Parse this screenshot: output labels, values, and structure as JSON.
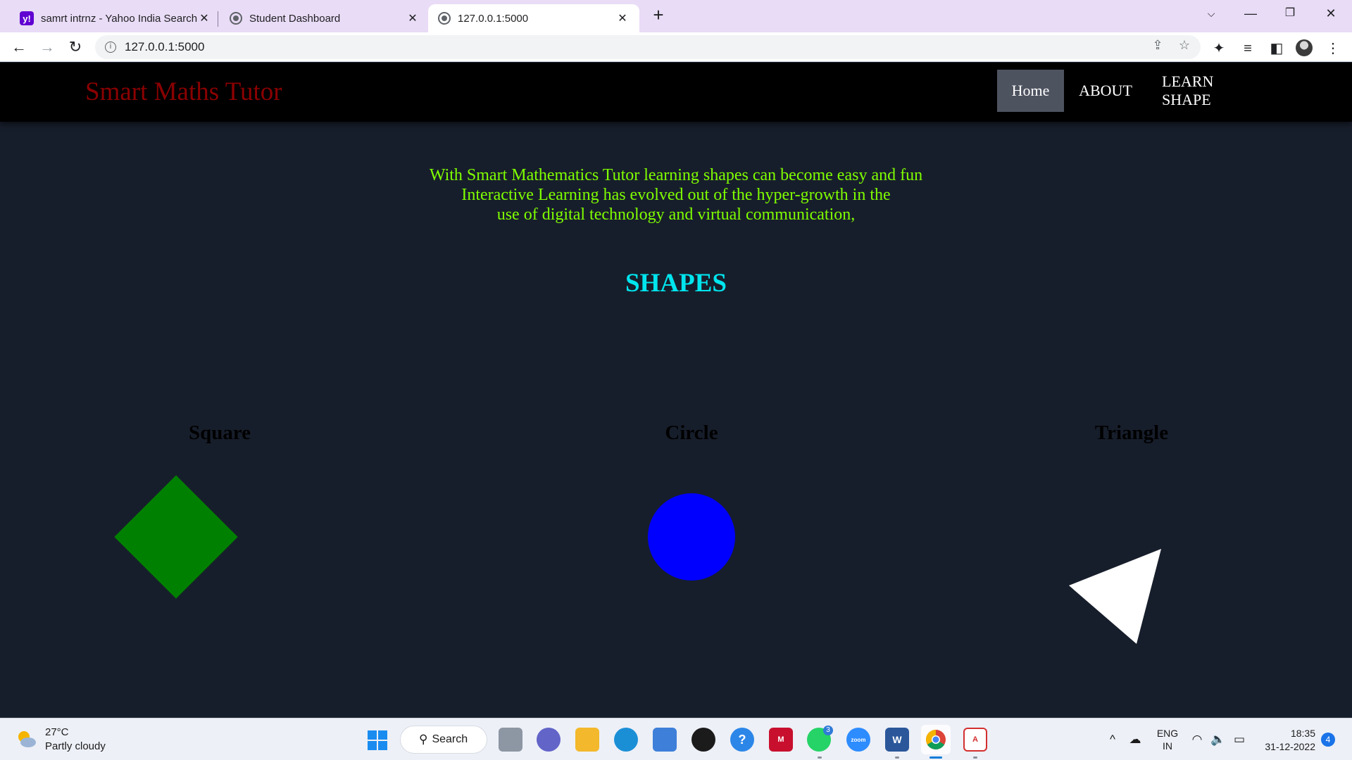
{
  "browser": {
    "tabs": [
      {
        "title": "samrt intrnz - Yahoo India Search",
        "favicon": "yahoo-icon",
        "active": false
      },
      {
        "title": "Student Dashboard",
        "favicon": "globe-icon",
        "active": false
      },
      {
        "title": "127.0.0.1:5000",
        "favicon": "globe-icon",
        "active": true
      }
    ],
    "url": "127.0.0.1:5000"
  },
  "site": {
    "brand": "Smart Maths Tutor",
    "nav": [
      {
        "label": "Home",
        "active": true
      },
      {
        "label": "ABOUT",
        "active": false
      },
      {
        "label": "LEARN SHAPE",
        "active": false
      }
    ],
    "intro_lines": [
      "With Smart Mathematics Tutor learning shapes can become easy and fun",
      "Interactive Learning has evolved out of the hyper-growth in the",
      "use of digital technology and virtual communication,"
    ],
    "heading": "SHAPES",
    "shapes": [
      {
        "label": "Square",
        "color": "#008000"
      },
      {
        "label": "Circle",
        "color": "#0000ff"
      },
      {
        "label": "Triangle",
        "color": "#ffffff"
      }
    ],
    "colors": {
      "background": "#171e2b",
      "navbar": "#000000",
      "brand": "#8b0000",
      "intro": "#7fff00",
      "heading": "#00e5ee"
    }
  },
  "taskbar": {
    "weather": {
      "temp": "27°C",
      "desc": "Partly cloudy"
    },
    "search_label": "Search",
    "whatsapp_badge": "3",
    "lang": {
      "line1": "ENG",
      "line2": "IN"
    },
    "clock": {
      "time": "18:35",
      "date": "31-12-2022"
    },
    "notifications": "4"
  }
}
